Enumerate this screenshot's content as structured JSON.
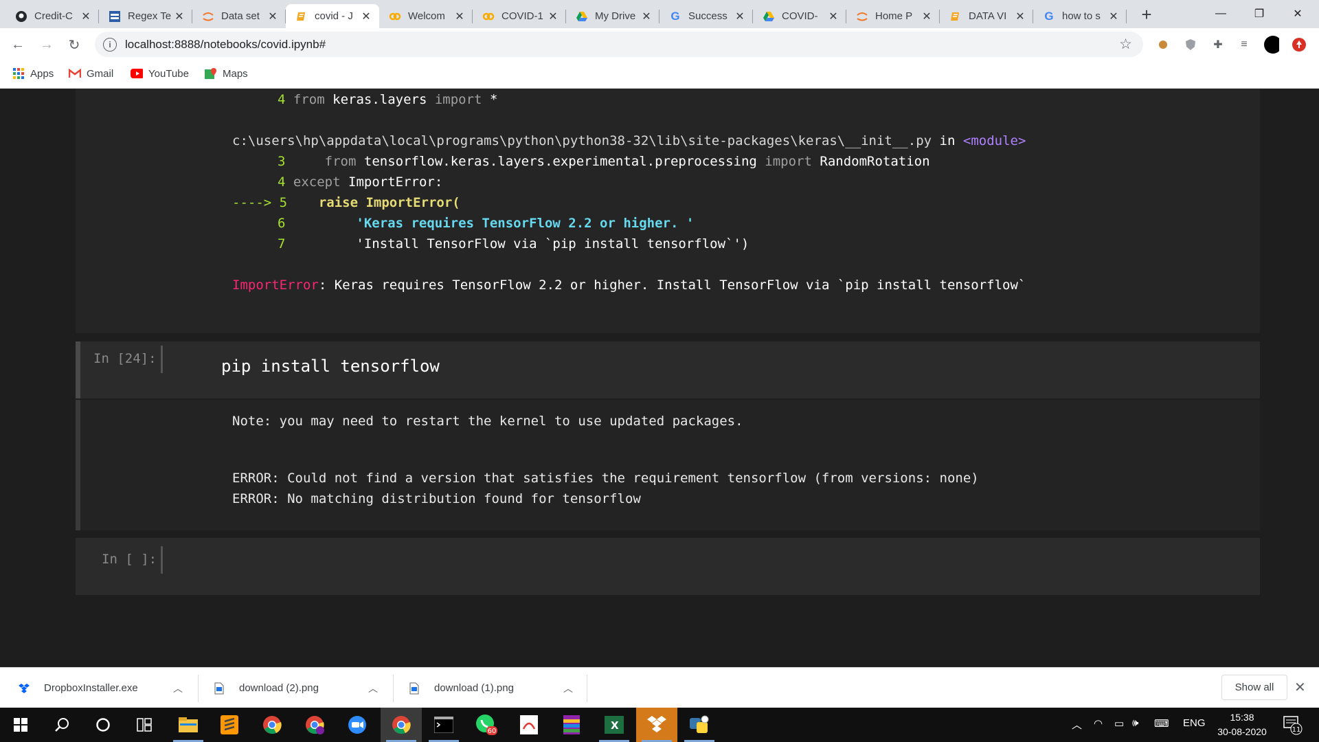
{
  "browser": {
    "tabs": [
      {
        "title": "Credit-C",
        "icon": "github-icon"
      },
      {
        "title": "Regex Te",
        "icon": "regex-icon"
      },
      {
        "title": "Data set",
        "icon": "jupyter-icon"
      },
      {
        "title": "covid - J",
        "icon": "notebook-icon",
        "active": true
      },
      {
        "title": "Welcom",
        "icon": "colab-icon"
      },
      {
        "title": "COVID-1",
        "icon": "colab-icon"
      },
      {
        "title": "My Drive",
        "icon": "drive-icon"
      },
      {
        "title": "Success",
        "icon": "google-icon"
      },
      {
        "title": "COVID-",
        "icon": "drive-icon"
      },
      {
        "title": "Home P",
        "icon": "jupyter-icon"
      },
      {
        "title": "DATA VI",
        "icon": "notebook-icon"
      },
      {
        "title": "how to s",
        "icon": "google-icon"
      }
    ],
    "url": "localhost:8888/notebooks/covid.ipynb#",
    "bookmarks": [
      {
        "label": "Apps",
        "icon": "apps-grid-icon"
      },
      {
        "label": "Gmail",
        "icon": "gmail-icon"
      },
      {
        "label": "YouTube",
        "icon": "youtube-icon"
      },
      {
        "label": "Maps",
        "icon": "maps-icon"
      }
    ]
  },
  "notebook": {
    "traceback": {
      "line1_num": "4",
      "line1_from": "from",
      "line1_mod": "keras.layers",
      "line1_import": "import",
      "line1_star": "*",
      "path": "c:\\users\\hp\\appdata\\local\\programs\\python\\python38-32\\lib\\site-packages\\keras\\__init__.py",
      "path_in": "in",
      "path_module": "<module>",
      "l3_num": "3",
      "l3_from": "from",
      "l3_mod": "tensorflow.keras.layers.experimental.preprocessing",
      "l3_import": "import",
      "l3_name": "RandomRotation",
      "l4_num": "4",
      "l4_except": "except",
      "l4_rest": "ImportError:",
      "l5_arrow": "----> 5",
      "l5_code": "raise ImportError(",
      "l6_num": "6",
      "l6_code": "'Keras requires TensorFlow 2.2 or higher. '",
      "l7_num": "7",
      "l7_code": "'Install TensorFlow via `pip install tensorflow`')",
      "error_name": "ImportError",
      "error_msg": ": Keras requires TensorFlow 2.2 or higher. Install TensorFlow via `pip install tensorflow`"
    },
    "cell24": {
      "prompt": "In [24]:",
      "code": "pip install tensorflow",
      "output": [
        "Note: you may need to restart the kernel to use updated packages.",
        "ERROR: Could not find a version that satisfies the requirement tensorflow (from versions: none)",
        "ERROR: No matching distribution found for tensorflow"
      ]
    },
    "empty_cell": {
      "prompt": "In [ ]:"
    }
  },
  "downloads": {
    "items": [
      {
        "name": "DropboxInstaller.exe",
        "icon": "dropbox-icon"
      },
      {
        "name": "download (2).png",
        "icon": "image-file-icon"
      },
      {
        "name": "download (1).png",
        "icon": "image-file-icon"
      }
    ],
    "show_all": "Show all"
  },
  "taskbar": {
    "language": "ENG",
    "time": "15:38",
    "date": "30-08-2020",
    "notifications": "11",
    "whatsapp_badge": "60"
  }
}
